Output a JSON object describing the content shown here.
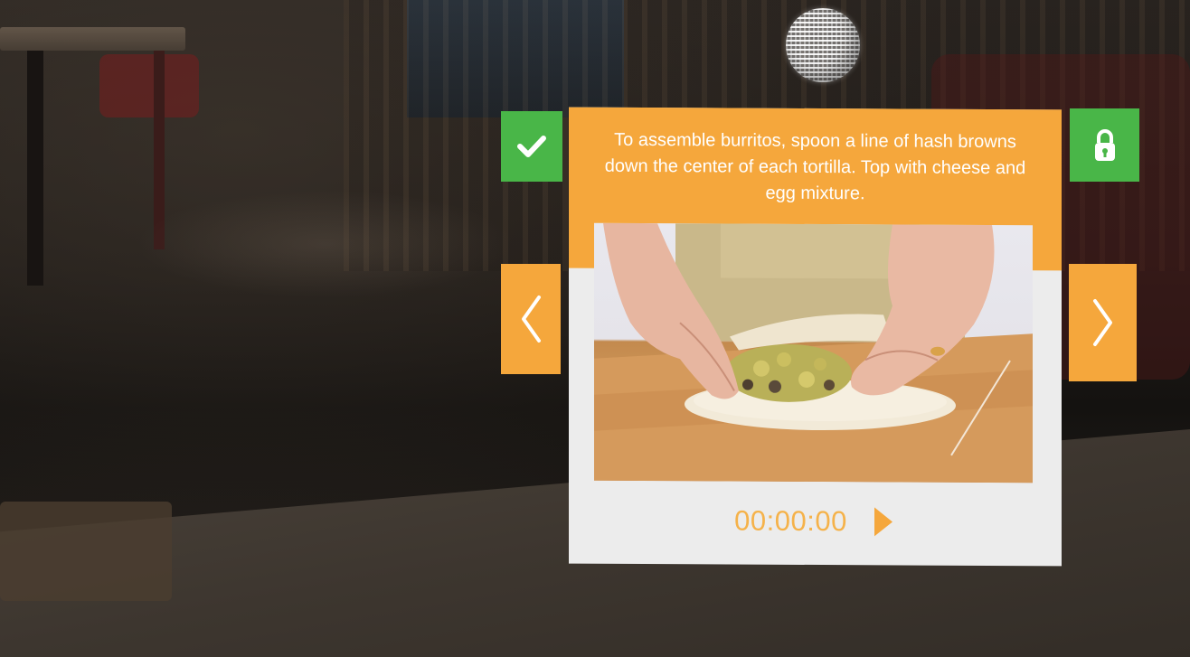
{
  "card": {
    "instruction": "To assemble burritos, spoon a line of hash browns down the center of each tortilla. Top with cheese and egg mixture.",
    "timer": "00:00:00"
  },
  "buttons": {
    "complete": "check-icon",
    "lock": "lock-icon",
    "previous": "chevron-left-icon",
    "next": "chevron-right-icon",
    "play": "play-icon"
  },
  "colors": {
    "accent_orange": "#f5a73c",
    "accent_green": "#49b648",
    "card_background": "#ececec",
    "timer_text": "#f5b24a"
  }
}
